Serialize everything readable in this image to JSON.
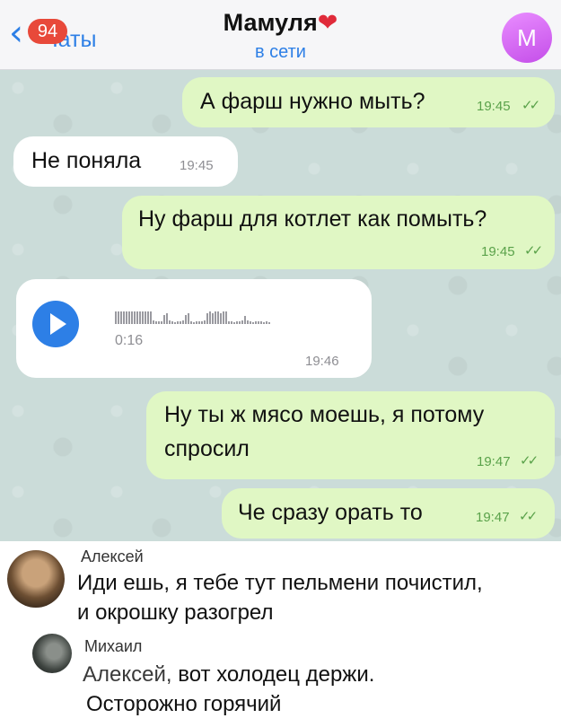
{
  "header": {
    "back_label": "Чаты",
    "unread_count": "94",
    "title": "Мамуля",
    "title_emoji": "❤",
    "status": "в сети",
    "avatar_letter": "М"
  },
  "messages": [
    {
      "text": "А фарш нужно мыть?",
      "time": "19:45",
      "checks": "✓✓"
    },
    {
      "text": "Не поняла",
      "time": "19:45"
    },
    {
      "text": "Ну фарш для котлет как помыть?",
      "time": "19:45",
      "checks": "✓✓"
    },
    {
      "voice_duration": "0:16",
      "time": "19:46"
    },
    {
      "text_line1": "Ну ты ж мясо моешь, я потому",
      "text_line2": "спросил",
      "time": "19:47",
      "checks": "✓✓"
    },
    {
      "text": "Че сразу орать то",
      "time": "19:47",
      "checks": "✓✓"
    }
  ],
  "comments": [
    {
      "author": "Алексей",
      "line1": "Иди ешь, я тебе тут пельмени почистил,",
      "line2": "и окрошку разогрел"
    },
    {
      "author": "Михаил",
      "mention": "Алексей,",
      "line1": " вот холодец держи.",
      "line2": "Осторожно горячий"
    }
  ],
  "colors": {
    "accent": "#2d7fe6",
    "outgoing_bubble": "#e0f7c4",
    "incoming_bubble": "#ffffff",
    "badge": "#e8493a"
  }
}
